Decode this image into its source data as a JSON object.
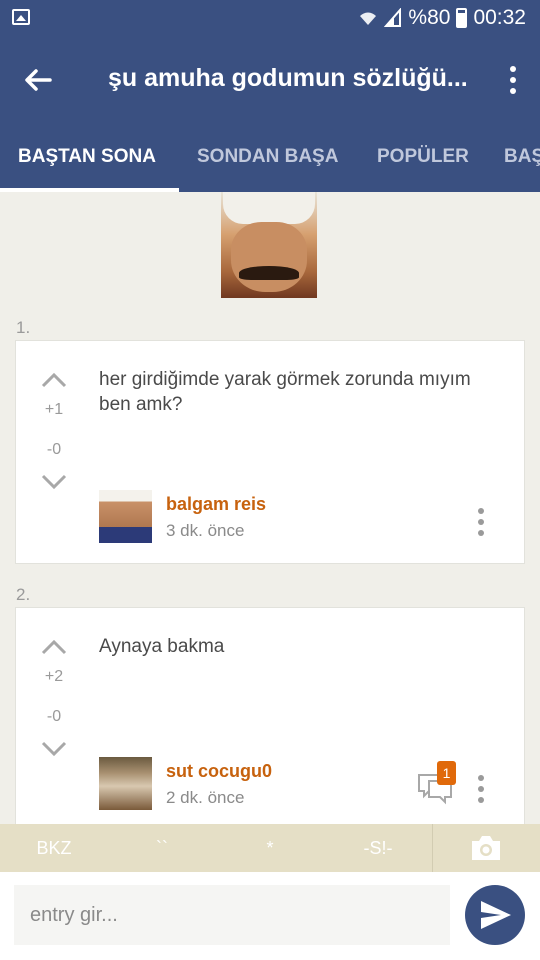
{
  "status_bar": {
    "battery": "%80",
    "time": "00:32",
    "icons": [
      "gallery-icon",
      "wifi-icon",
      "signal-icon",
      "battery-icon"
    ]
  },
  "app_bar": {
    "title": "şu amuha godumun sözlüğü...",
    "back_icon": "arrow-left-icon",
    "menu_icon": "more-vertical-icon"
  },
  "tabs": [
    {
      "label": "BAŞTAN SONA",
      "active": true
    },
    {
      "label": "SONDAN BAŞA",
      "active": false
    },
    {
      "label": "POPÜLER",
      "active": false
    },
    {
      "label": "BAŞ",
      "active": false
    }
  ],
  "entries": [
    {
      "number": "1.",
      "text": "her girdiğimde yarak görmek zorunda mıyım ben amk?",
      "upvotes": "+1",
      "downvotes": "-0",
      "author": "balgam reis",
      "time": "3 dk. önce"
    },
    {
      "number": "2.",
      "text": "Aynaya bakma",
      "upvotes": "+2",
      "downvotes": "-0",
      "author": "sut cocugu0",
      "time": "2 dk. önce",
      "comment_count": "1"
    }
  ],
  "toolbar": {
    "bkz": "BKZ",
    "backtick": "``",
    "star": "*",
    "spoiler": "-S!-",
    "camera_icon": "camera-icon"
  },
  "composer": {
    "placeholder": "entry gir...",
    "send_icon": "send-icon"
  },
  "colors": {
    "primary": "#3a5081",
    "accent": "#c7620e",
    "badge": "#e0690a",
    "toolbar": "#e5dfc6",
    "background": "#f0efe9"
  }
}
